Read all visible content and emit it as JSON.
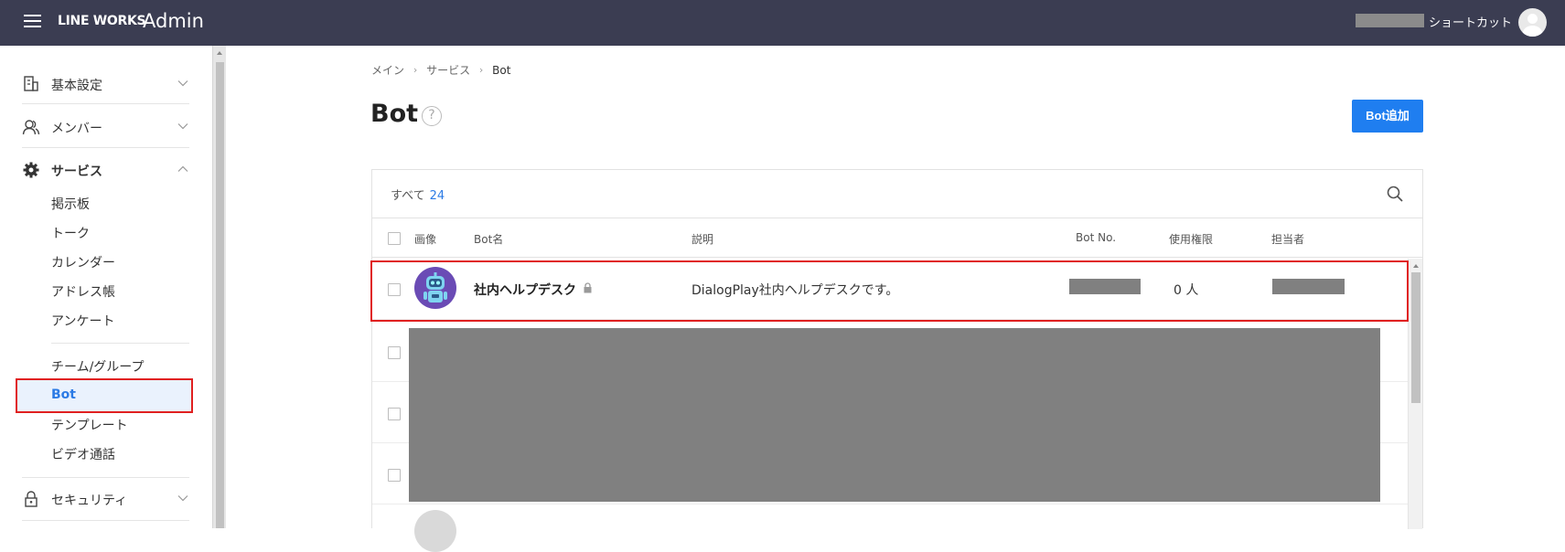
{
  "header": {
    "logo_lineworks": "LINE WORKS",
    "logo_admin": "Admin",
    "shortcut_label": "ショートカット"
  },
  "sidebar": {
    "groups": [
      {
        "label": "基本設定",
        "icon": "building-icon",
        "expanded": false
      },
      {
        "label": "メンバー",
        "icon": "members-icon",
        "expanded": false
      },
      {
        "label": "サービス",
        "icon": "gear-icon",
        "expanded": true
      },
      {
        "label": "セキュリティ",
        "icon": "lock-icon",
        "expanded": false
      }
    ],
    "service_items": [
      "掲示板",
      "トーク",
      "カレンダー",
      "アドレス帳",
      "アンケート"
    ],
    "service_items_2": [
      "チーム/グループ",
      "Bot",
      "テンプレート",
      "ビデオ通話"
    ],
    "active_item": "Bot"
  },
  "breadcrumb": [
    "メイン",
    "サービス",
    "Bot"
  ],
  "page": {
    "title": "Bot",
    "help_icon": "?",
    "add_button": "Bot追加"
  },
  "filter": {
    "all_label": "すべて",
    "count": "24"
  },
  "table": {
    "columns": [
      "画像",
      "Bot名",
      "説明",
      "Bot No.",
      "使用権限",
      "担当者"
    ],
    "rows": [
      {
        "name": "社内ヘルプデスク",
        "locked": true,
        "description": "DialogPlay社内ヘルプデスクです。",
        "bot_no": "",
        "permission": "0 人",
        "owner": ""
      }
    ]
  },
  "colors": {
    "topbar": "#3b3d52",
    "accent": "#1f7ef0",
    "highlight": "#e02020",
    "redaction": "#808080"
  }
}
